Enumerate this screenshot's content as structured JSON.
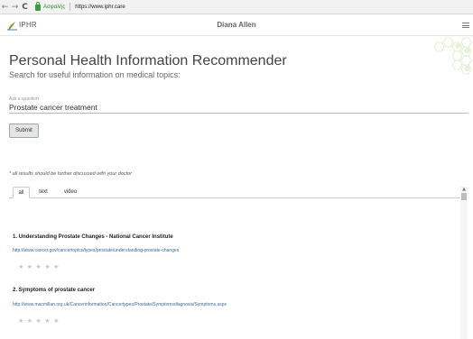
{
  "browser": {
    "back": "←",
    "forward": "→",
    "refresh": "C",
    "secure_label": "Ασφαλής",
    "url": "https://www.iphr.care"
  },
  "header": {
    "brand": "IPHR",
    "user": "Diana Allen"
  },
  "main": {
    "title": "Personal Health Information Recommender",
    "subtitle": "Search for useful information on medical topics:",
    "question_label": "Ask a question",
    "question_value": "Prostate cancer treatment",
    "submit_label": "Submit",
    "disclaimer": "* all results should be further discussed with your doctor"
  },
  "tabs": [
    {
      "label": "all",
      "active": true
    },
    {
      "label": "text",
      "active": false
    },
    {
      "label": "video",
      "active": false
    }
  ],
  "results": [
    {
      "title": "1. Understanding Prostate Changes - National Cancer Institute",
      "url": "http://www.cancer.gov/cancertopics/types/prostate/understanding-prostate-changes",
      "stars": "★★★★★",
      "rating": 0
    },
    {
      "title": "2. Symptoms of prostate cancer",
      "url": "http://www.macmillan.org.uk/Cancerinformation/Cancertypes/Prostate/Symptomsdiagnosis/Symptoms.aspx",
      "stars": "★★★★★",
      "rating": 0
    }
  ],
  "colors": {
    "accent_green": "#8ab544",
    "link": "#3b6a9c",
    "star_empty": "#c8c8c8"
  }
}
